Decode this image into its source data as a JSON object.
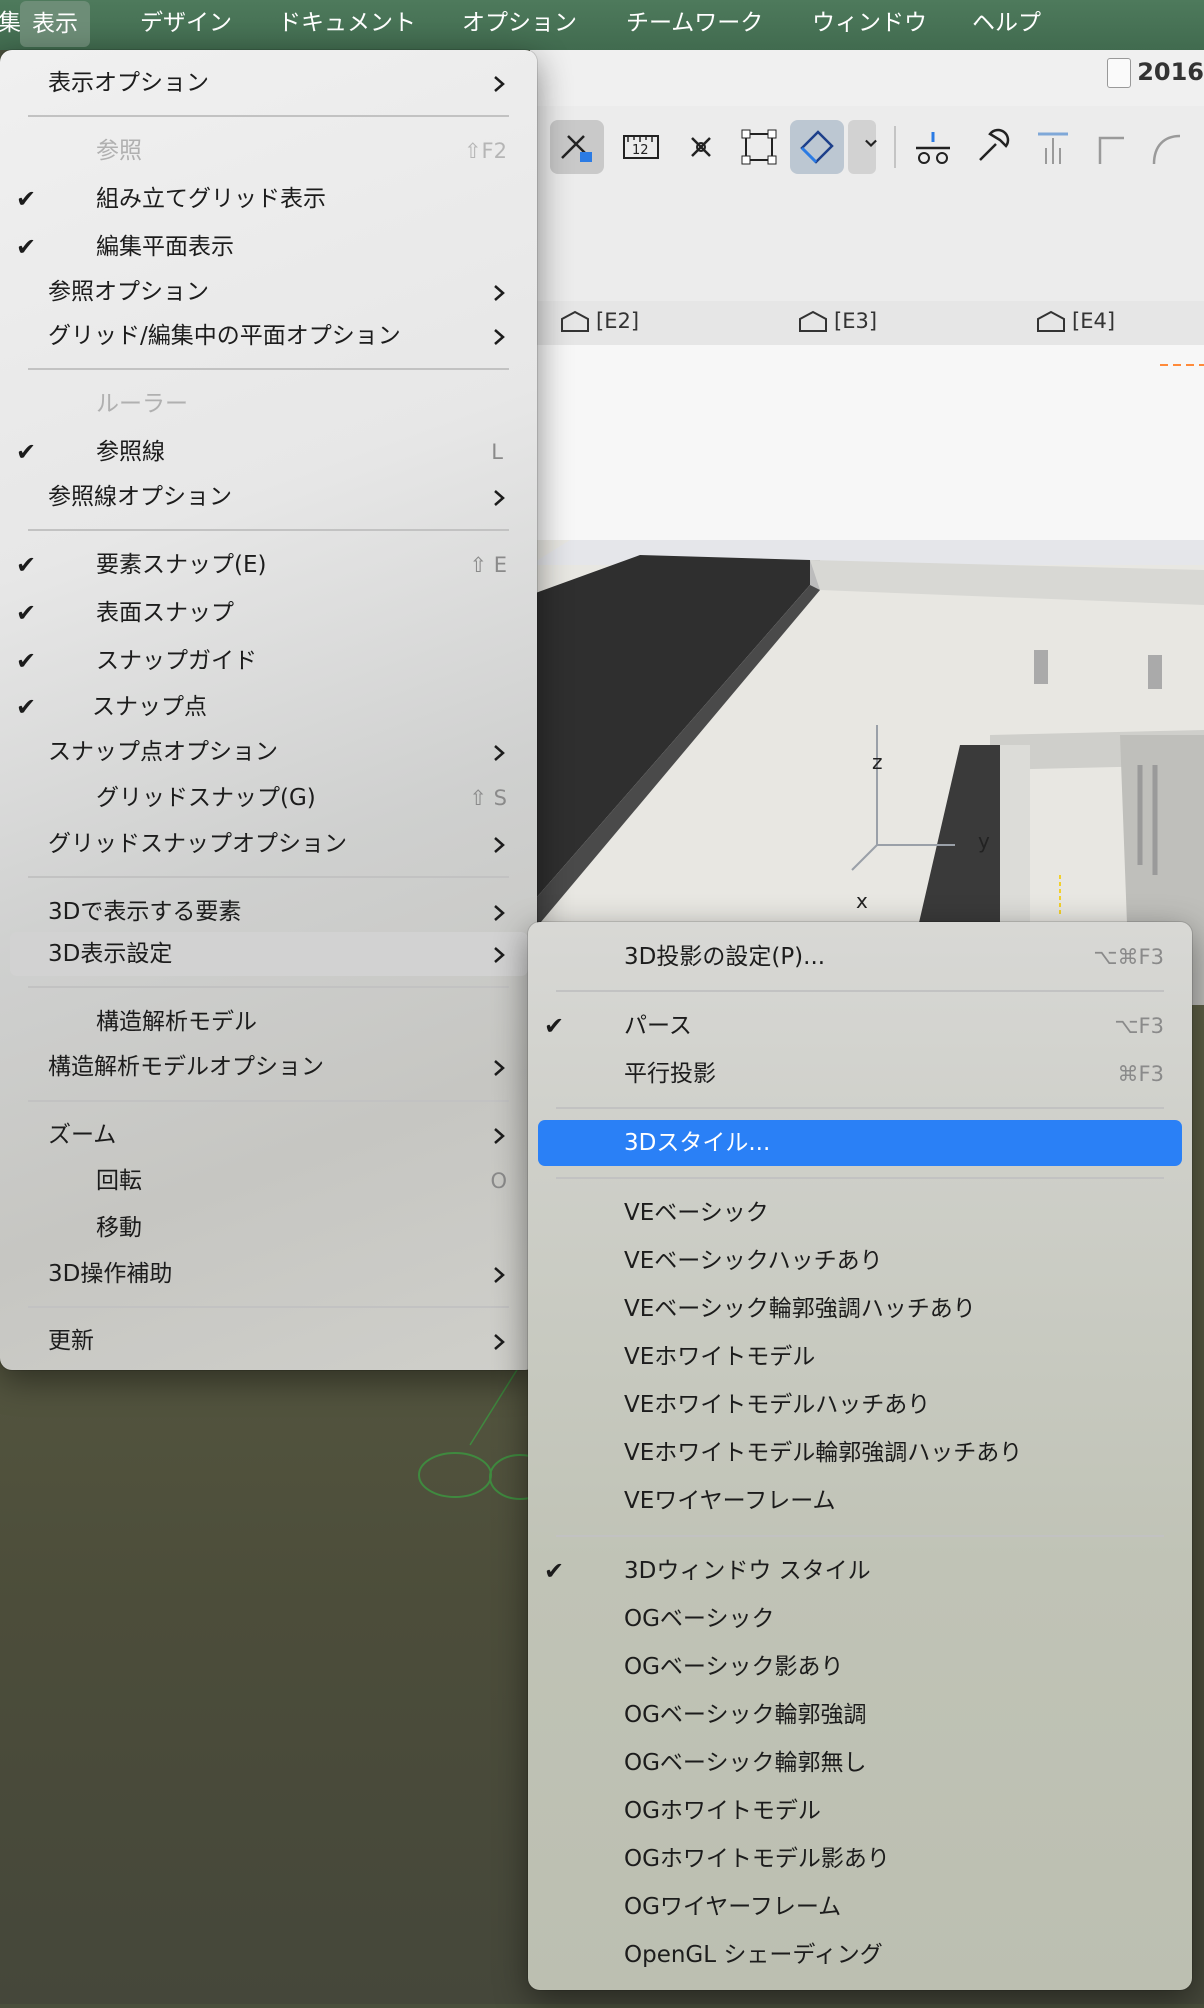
{
  "menubar": {
    "items": [
      {
        "label": "集"
      },
      {
        "label": "表示"
      },
      {
        "label": "デザイン"
      },
      {
        "label": "ドキュメント"
      },
      {
        "label": "オプション"
      },
      {
        "label": "チームワーク"
      },
      {
        "label": "ウィンドウ"
      },
      {
        "label": "ヘルプ"
      }
    ]
  },
  "window": {
    "doc_title": "2016"
  },
  "viewport": {
    "tabs": [
      "[E2]",
      "[E3]",
      "[E4]"
    ],
    "axes": {
      "z": "z",
      "y": "y",
      "x": "x"
    }
  },
  "main_menu": {
    "items": [
      {
        "label": "表示オプション"
      },
      {
        "label": "参照",
        "shortcut": "⇧F2"
      },
      {
        "label": "組み立てグリッド表示"
      },
      {
        "label": "編集平面表示"
      },
      {
        "label": "参照オプション"
      },
      {
        "label": "グリッド/編集中の平面オプション"
      },
      {
        "label": "ルーラー"
      },
      {
        "label": "参照線",
        "shortcut": "L"
      },
      {
        "label": "参照線オプション"
      },
      {
        "label": "要素スナップ(E)",
        "shortcut": "⇧ E"
      },
      {
        "label": "表面スナップ"
      },
      {
        "label": "スナップガイド"
      },
      {
        "label": "スナップ点"
      },
      {
        "label": "スナップ点オプション"
      },
      {
        "label": "グリッドスナップ(G)",
        "shortcut": "⇧ S"
      },
      {
        "label": "グリッドスナップオプション"
      },
      {
        "label": "3Dで表示する要素"
      },
      {
        "label": "3D表示設定"
      },
      {
        "label": "構造解析モデル"
      },
      {
        "label": "構造解析モデルオプション"
      },
      {
        "label": "ズーム"
      },
      {
        "label": "回転",
        "shortcut": "O"
      },
      {
        "label": "移動"
      },
      {
        "label": "3D操作補助"
      },
      {
        "label": "更新"
      }
    ]
  },
  "sub_menu": {
    "items": [
      {
        "label": "3D投影の設定(P)...",
        "shortcut": "⌥⌘F3"
      },
      {
        "label": "パース",
        "shortcut": "⌥F3"
      },
      {
        "label": "平行投影",
        "shortcut": "⌘F3"
      },
      {
        "label": "3Dスタイル..."
      },
      {
        "label": "VEベーシック"
      },
      {
        "label": "VEベーシックハッチあり"
      },
      {
        "label": "VEベーシック輪郭強調ハッチあり"
      },
      {
        "label": "VEホワイトモデル"
      },
      {
        "label": "VEホワイトモデルハッチあり"
      },
      {
        "label": "VEホワイトモデル輪郭強調ハッチあり"
      },
      {
        "label": "VEワイヤーフレーム"
      },
      {
        "label": "3Dウィンドウ スタイル"
      },
      {
        "label": "OGベーシック"
      },
      {
        "label": "OGベーシック影あり"
      },
      {
        "label": "OGベーシック輪郭強調"
      },
      {
        "label": "OGベーシック輪郭無し"
      },
      {
        "label": "OGホワイトモデル"
      },
      {
        "label": "OGホワイトモデル影あり"
      },
      {
        "label": "OGワイヤーフレーム"
      },
      {
        "label": "OpenGL シェーディング"
      }
    ]
  },
  "check_glyph": "✔"
}
